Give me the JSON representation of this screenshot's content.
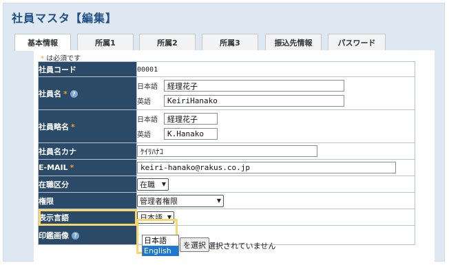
{
  "page": {
    "title": "社員マスタ【編集】"
  },
  "tabs": [
    {
      "label": "基本情報",
      "active": true
    },
    {
      "label": "所属1"
    },
    {
      "label": "所属2"
    },
    {
      "label": "所属3"
    },
    {
      "label": "振込先情報"
    },
    {
      "label": "パスワード"
    }
  ],
  "form": {
    "required_mark": "*",
    "required_note": "は必須です",
    "help_icon": "?",
    "employee_code": {
      "label": "社員コード",
      "value": "00001"
    },
    "employee_name": {
      "label": "社員名",
      "ja_label": "日本語",
      "ja_value": "経理花子",
      "en_label": "英語",
      "en_value": "KeiriHanako"
    },
    "short_name": {
      "label": "社員略名",
      "ja_label": "日本語",
      "ja_value": "経理花子",
      "en_label": "英語",
      "en_value": "K.Hanako"
    },
    "kana": {
      "label": "社員名カナ",
      "value": "ｹｲﾘﾊﾅｺ"
    },
    "email": {
      "label": "E-MAIL",
      "value": "keiri-hanako@rakus.co.jp"
    },
    "employment_status": {
      "label": "在職区分",
      "selected": "在職"
    },
    "permission": {
      "label": "権限",
      "selected": "管理者権限"
    },
    "display_language": {
      "label": "表示言語",
      "selected": "日本語",
      "options": [
        "日本語",
        "English"
      ],
      "hovered": "English"
    },
    "seal_image": {
      "label": "印鑑画像",
      "button": "を選択",
      "status": "選択されていません"
    }
  },
  "colors": {
    "label_bg": "#2b4a68",
    "title": "#1f4f86",
    "highlight": "#f6d66e",
    "hover": "#1e77d3",
    "required": "#f29a2e"
  }
}
